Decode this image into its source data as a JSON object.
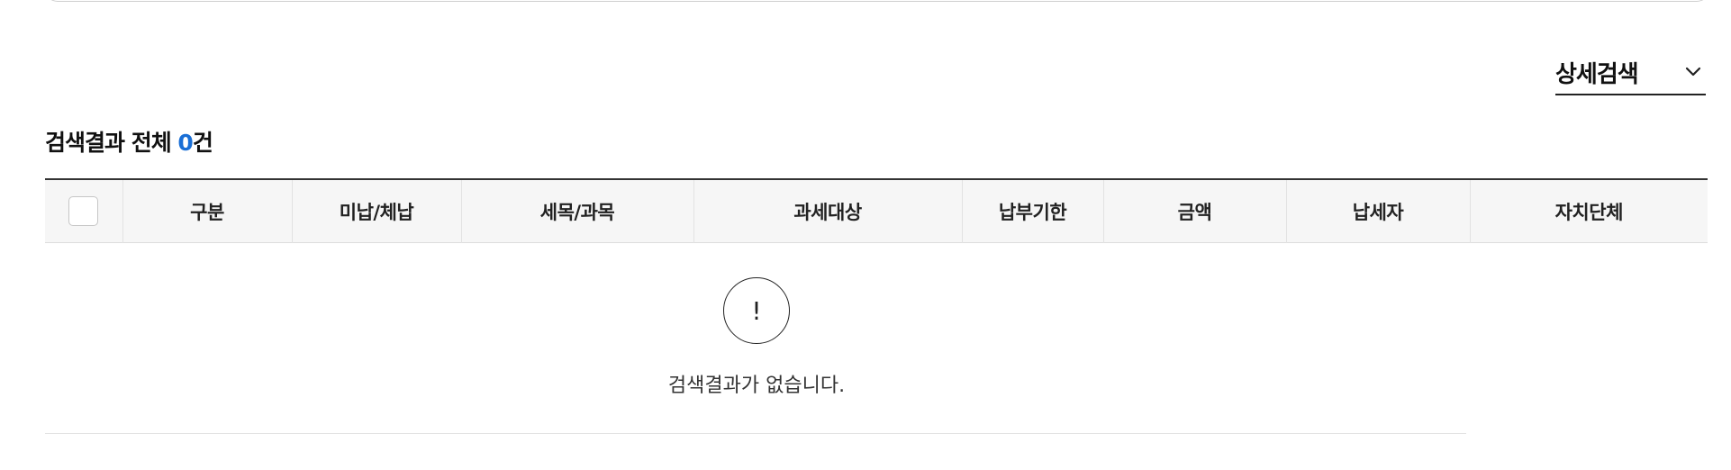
{
  "detail_search": {
    "label": "상세검색",
    "icon": "chevron-down-icon"
  },
  "result_summary": {
    "prefix": "검색결과 전체 ",
    "count": "0",
    "suffix": "건",
    "count_color": "#1a6fd6"
  },
  "table": {
    "columns": [
      "구분",
      "미납/체납",
      "세목/과목",
      "과세대상",
      "납부기한",
      "금액",
      "납세자",
      "자치단체"
    ],
    "rows": []
  },
  "empty_state": {
    "icon": "exclamation-icon",
    "icon_glyph": "!",
    "message": "검색결과가 없습니다."
  }
}
